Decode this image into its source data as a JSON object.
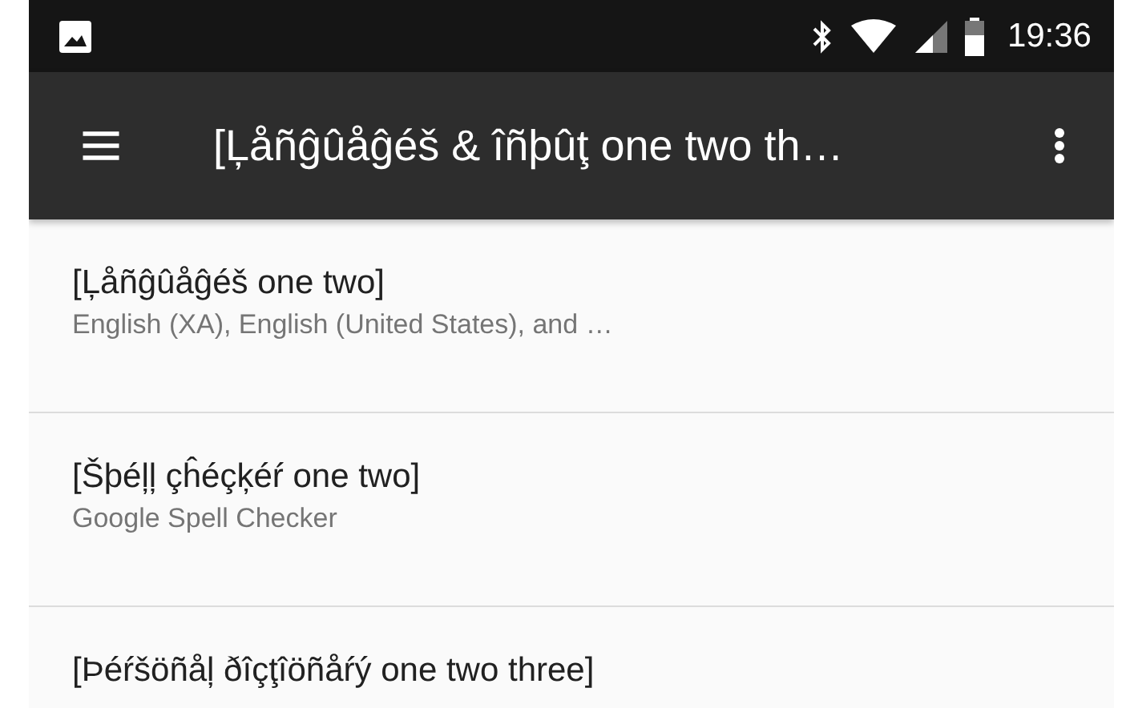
{
  "status_bar": {
    "time": "19:36"
  },
  "toolbar": {
    "title": "[Ļåñĝûåĝéš & îñþûţ one two th…"
  },
  "items": [
    {
      "title": "[Ļåñĝûåĝéš one two]",
      "summary": "English (XA), English (United States), and …"
    },
    {
      "title": "[Šþéļļ çĥéçķéŕ one two]",
      "summary": "Google Spell Checker"
    },
    {
      "title": "[Þéŕšöñåļ ðîçţîöñåŕý one two three]"
    }
  ]
}
